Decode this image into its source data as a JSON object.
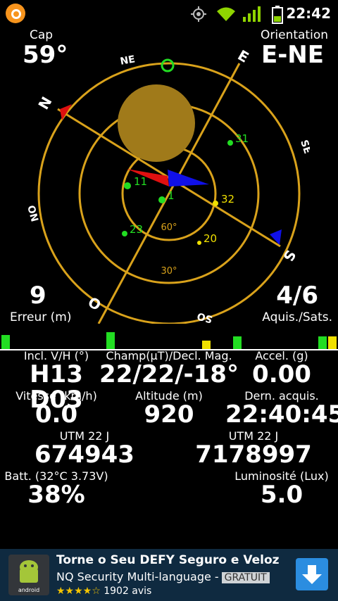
{
  "status": {
    "time": "22:42"
  },
  "header": {
    "cap_label": "Cap",
    "cap_value": "59°",
    "orient_label": "Orientation",
    "orient_value": "E-NE"
  },
  "compass": {
    "dirs": [
      "NE",
      "E",
      "SE",
      "S",
      "SO",
      "O",
      "NO",
      "N"
    ],
    "ring_labels": [
      "60°",
      "30°"
    ],
    "sats": [
      {
        "id": "31",
        "color": "#22dd22"
      },
      {
        "id": "11",
        "color": "#22dd22"
      },
      {
        "id": "1",
        "color": "#22dd22"
      },
      {
        "id": "23",
        "color": "#22dd22"
      },
      {
        "id": "32",
        "color": "#f0e000"
      },
      {
        "id": "20",
        "color": "#f0e000"
      }
    ]
  },
  "info": {
    "error_value": "9",
    "error_label": "Erreur (m)",
    "sats_value": "4/6",
    "sats_label": "Aquis./Sats."
  },
  "stats": {
    "incl_label": "Incl. V/H (°)",
    "incl_value": "H13 D03",
    "champ_label": "Champ(µT)/Decl. Mag.",
    "champ_value": "22/22/-18°",
    "accel_label": "Accel. (g)",
    "accel_value": "0.00",
    "speed_label": "Vitesse (km/h)",
    "speed_value": "0.0",
    "alt_label": "Altitude (m)",
    "alt_value": "920",
    "last_label": "Dern. acquis.",
    "last_value": "22:40:45",
    "utm1_label": "UTM 22 J",
    "utm1_value": "674943",
    "utm2_label": "UTM 22 J",
    "utm2_value": "7178997",
    "batt_label": "Batt. (32°C 3.73V)",
    "batt_value": "38%",
    "lux_label": "Luminosité (Lux)",
    "lux_value": "5.0"
  },
  "ad": {
    "title": "Torne o Seu DEFY Seguro e Veloz",
    "subtitle": "NQ Security Multi-language -",
    "badge": "GRATUIT",
    "stars": "★★★★☆",
    "reviews": "1902 avis",
    "logo_text": "android"
  }
}
